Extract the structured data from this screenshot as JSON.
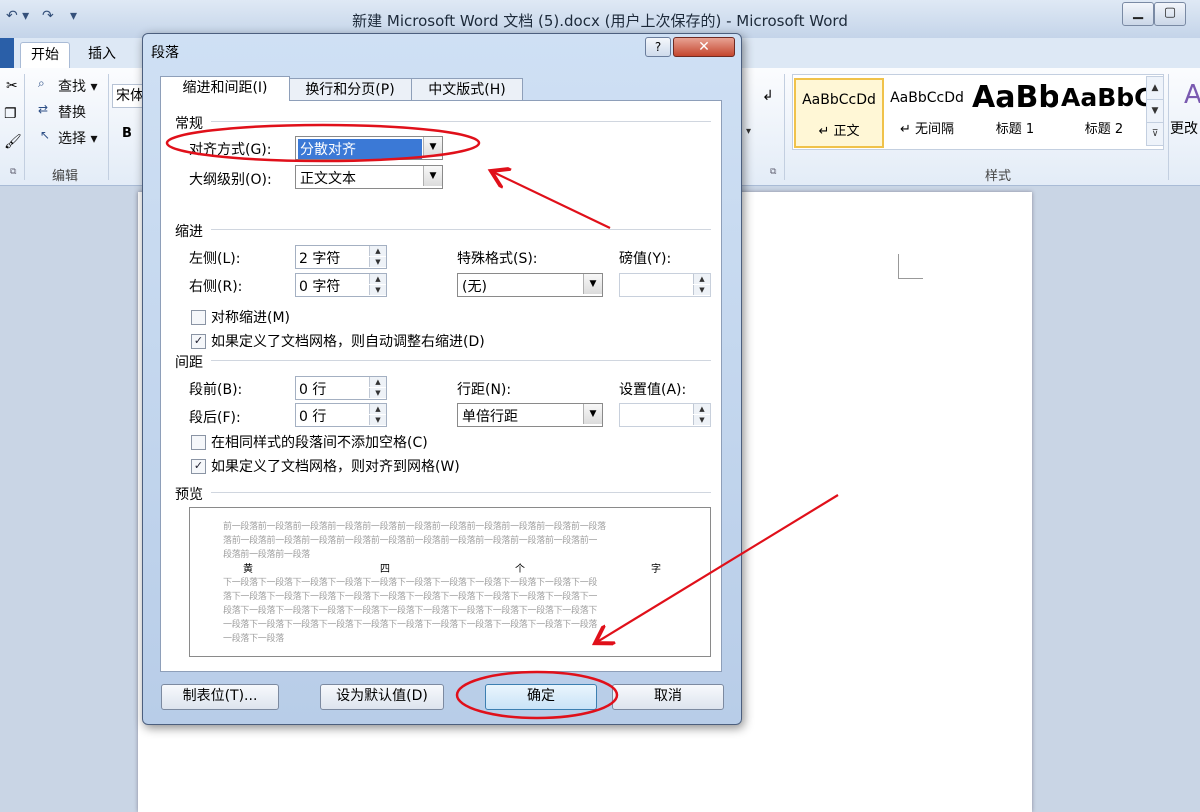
{
  "window": {
    "title": "新建 Microsoft Word 文档 (5).docx (用户上次保存的) - Microsoft Word",
    "minimize": "▁",
    "maximize": "▢"
  },
  "ribbon": {
    "tabs": {
      "home": "开始",
      "insert": "插入"
    },
    "edit": {
      "find": "查找 ▾",
      "replace": "替换",
      "select": "选择 ▾",
      "label": "编辑"
    },
    "font_name": "宋体",
    "bold": "B",
    "styles": {
      "label": "样式",
      "more_label": "更改",
      "tiles": [
        {
          "sample": "AaBbCcDd",
          "name": "↵ 正文"
        },
        {
          "sample": "AaBbCcDd",
          "name": "↵ 无间隔"
        },
        {
          "sample": "AaBb",
          "name": "标题 1"
        },
        {
          "sample": "AaBbC",
          "name": "标题 2"
        }
      ]
    }
  },
  "dialog": {
    "title": "段落",
    "help": "?",
    "close": "✕",
    "tabs": [
      "缩进和间距(I)",
      "换行和分页(P)",
      "中文版式(H)"
    ],
    "general": {
      "section": "常规",
      "alignment_label": "对齐方式(G):",
      "alignment_value": "分散对齐",
      "outline_label": "大纲级别(O):",
      "outline_value": "正文文本"
    },
    "indent": {
      "section": "缩进",
      "left_label": "左侧(L):",
      "left_value": "2 字符",
      "right_label": "右侧(R):",
      "right_value": "0 字符",
      "special_label": "特殊格式(S):",
      "special_value": "(无)",
      "by_label": "磅值(Y):",
      "mirror_label": "对称缩进(M)",
      "mirror_checked": false,
      "auto_adjust_label": "如果定义了文档网格，则自动调整右缩进(D)",
      "auto_adjust_checked": true
    },
    "spacing": {
      "section": "间距",
      "before_label": "段前(B):",
      "before_value": "0 行",
      "after_label": "段后(F):",
      "after_value": "0 行",
      "line_label": "行距(N):",
      "line_value": "单倍行距",
      "at_label": "设置值(A):",
      "no_space_label": "在相同样式的段落间不添加空格(C)",
      "no_space_checked": false,
      "snap_label": "如果定义了文档网格，则对齐到网格(W)",
      "snap_checked": true
    },
    "preview": {
      "section": "预览",
      "prev_lines": [
        "前一段落前一段落前一段落前一段落前一段落前一段落前一段落前一段落前一段落前一段落前一段落",
        "落前一段落前一段落前一段落前一段落前一段落前一段落前一段落前一段落前一段落前一段落前一",
        "段落前一段落前一段落"
      ],
      "sample_chars": [
        "黄",
        "四",
        "个",
        "字"
      ],
      "next_lines": [
        "下一段落下一段落下一段落下一段落下一段落下一段落下一段落下一段落下一段落下一段落下一段",
        "落下一段落下一段落下一段落下一段落下一段落下一段落下一段落下一段落下一段落下一段落下一",
        "段落下一段落下一段落下一段落下一段落下一段落下一段落下一段落下一段落下一段落下一段落下",
        "一段落下一段落下一段落下一段落下一段落下一段落下一段落下一段落下一段落下一段落下一段落",
        "一段落下一段落"
      ]
    },
    "buttons": {
      "tabs": "制表位(T)...",
      "default": "设为默认值(D)",
      "ok": "确定",
      "cancel": "取消"
    }
  },
  "annotation_color": "#e0101a"
}
